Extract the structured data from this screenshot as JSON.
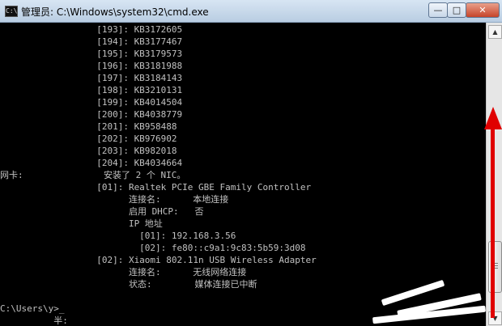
{
  "window": {
    "title": "管理员: C:\\Windows\\system32\\cmd.exe",
    "icon_text": "C:\\",
    "buttons": {
      "minimize": "—",
      "maximize": "□",
      "close": "✕"
    }
  },
  "console": {
    "lines": [
      "                  [193]: KB3172605",
      "                  [194]: KB3177467",
      "                  [195]: KB3179573",
      "                  [196]: KB3181988",
      "                  [197]: KB3184143",
      "                  [198]: KB3210131",
      "                  [199]: KB4014504",
      "                  [200]: KB4038779",
      "                  [201]: KB958488",
      "                  [202]: KB976902",
      "                  [203]: KB982018",
      "                  [204]: KB4034664",
      "网卡:               安装了 2 个 NIC。",
      "                  [01]: Realtek PCIe GBE Family Controller",
      "                        连接名:      本地连接",
      "                        启用 DHCP:   否",
      "                        IP 地址",
      "                          [01]: 192.168.3.56",
      "                          [02]: fe80::c9a1:9c83:5b59:3d08",
      "                  [02]: Xiaomi 802.11n USB Wireless Adapter",
      "                        连接名:      无线网络连接",
      "                        状态:        媒体连接已中断",
      "",
      "C:\\Users\\y>_",
      "          半:"
    ]
  },
  "scrollbar": {
    "up": "▲",
    "down": "▼"
  },
  "colors": {
    "console_bg": "#000000",
    "console_fg": "#c0c0c0",
    "arrow": "#e00000"
  }
}
